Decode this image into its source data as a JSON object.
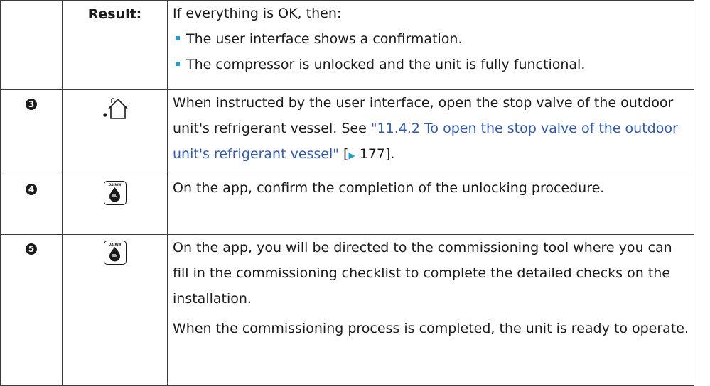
{
  "rows": [
    {
      "label": "Result:",
      "intro": "If everything is OK, then:",
      "bullets": [
        "The user interface shows a confirmation.",
        "The compressor is unlocked and the unit is fully functional."
      ]
    },
    {
      "number": "3",
      "icon": "house-icon",
      "text_before": "When instructed by the user interface, open the stop valve of the outdoor unit's refrigerant vessel. See ",
      "link": "\"11.4.2 To open the stop valve of the outdoor unit's refrigerant vessel\"",
      "ref_open": " [",
      "ref_arrow": "▶",
      "ref_page": " 177].",
      "text_after": ""
    },
    {
      "number": "4",
      "icon": "daikin-app-icon",
      "icon_text": "DAIKIN",
      "text": "On the app, confirm the completion of the unlocking procedure."
    },
    {
      "number": "5",
      "icon": "daikin-app-icon",
      "icon_text": "DAIKIN",
      "text": "On the app, you will be directed to the commissioning tool where you can fill in the commissioning checklist to complete the detailed checks on the installation.",
      "text2": "When the commissioning process is completed, the unit is ready to operate."
    }
  ],
  "colors": {
    "bullet": "#1a9fd8",
    "link": "#2c57c7",
    "border": "#3c3c3c"
  }
}
